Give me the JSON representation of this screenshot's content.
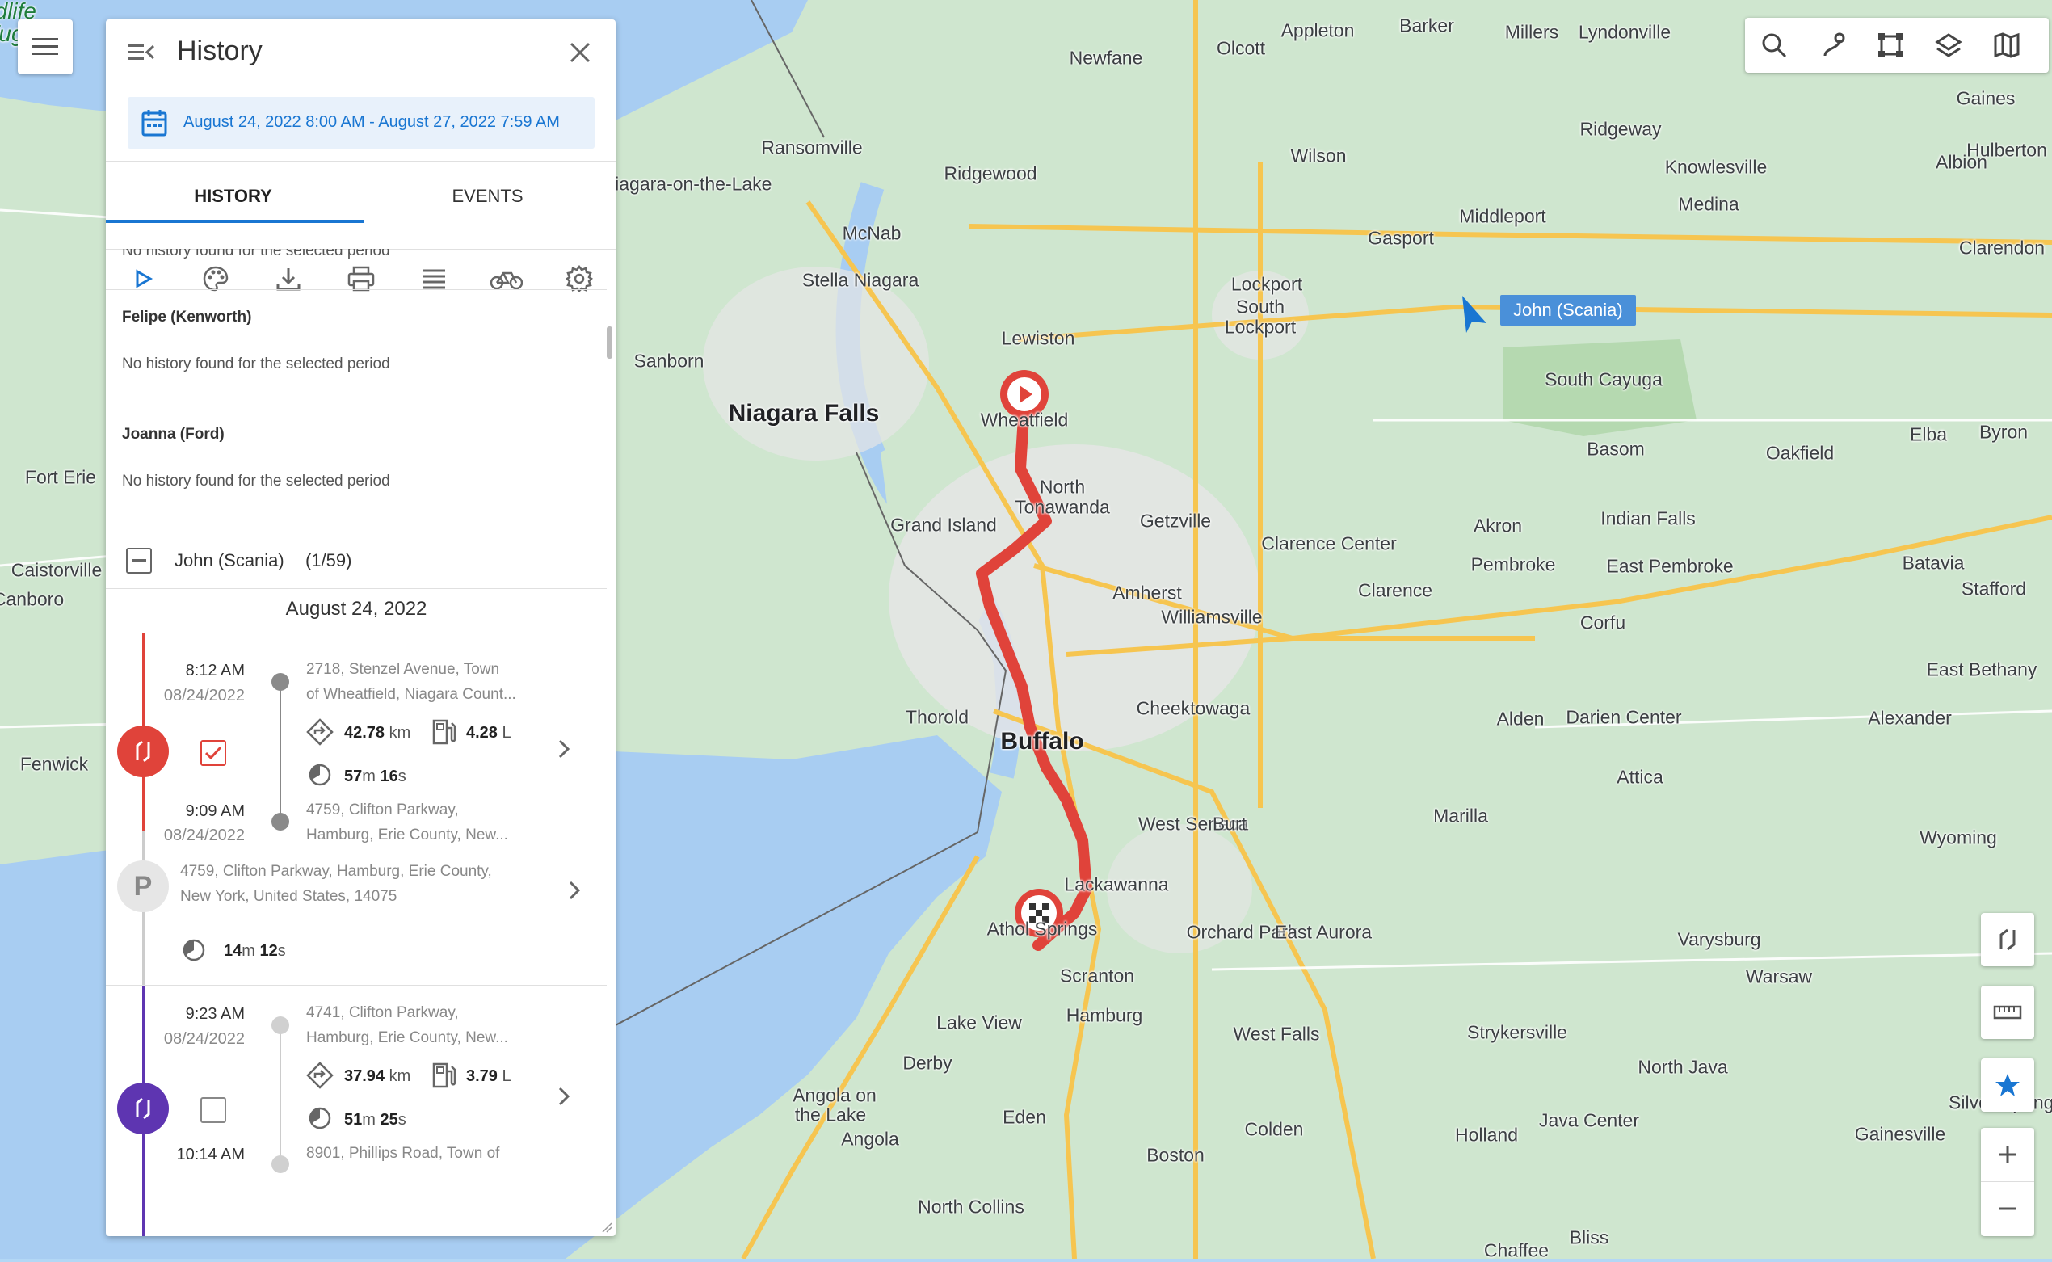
{
  "panel": {
    "title": "History",
    "date_range": "August 24, 2022 8:00 AM - August 27, 2022 7:59 AM",
    "tabs": [
      {
        "label": "HISTORY"
      },
      {
        "label": "EVENTS"
      }
    ],
    "active_tab": "HISTORY",
    "tools": [
      "play-icon",
      "palette-icon",
      "download-icon",
      "print-icon",
      "list-icon",
      "bike-icon",
      "gear-icon"
    ],
    "cut_text": "No history found for the selected period",
    "vehicles": [
      {
        "name": "Felipe (Kenworth)",
        "message": "No history found for the selected period"
      },
      {
        "name": "Joanna (Ford)",
        "message": "No history found for the selected period"
      }
    ],
    "group": {
      "name": "John (Scania)",
      "count": "(1/59)"
    },
    "day_header": "August 24, 2022",
    "trip1": {
      "start_time": "8:12 AM",
      "start_date": "08/24/2022",
      "start_addr1": "2718, Stenzel Avenue, Town",
      "start_addr2": "of Wheatfield, Niagara Count...",
      "distance": "42.78",
      "distance_unit": "km",
      "fuel": "4.28",
      "fuel_unit": "L",
      "dur_m": "57",
      "dur_m_unit": "m",
      "dur_s": "16",
      "dur_s_unit": "s",
      "end_time": "9:09 AM",
      "end_date": "08/24/2022",
      "end_addr1": "4759, Clifton Parkway,",
      "end_addr2": "Hamburg, Erie County, New..."
    },
    "stop": {
      "badge": "P",
      "addr1": "4759, Clifton Parkway, Hamburg, Erie County,",
      "addr2": "New York, United States, 14075",
      "dur_m": "14",
      "dur_m_unit": "m",
      "dur_s": "12",
      "dur_s_unit": "s"
    },
    "trip2": {
      "start_time": "9:23 AM",
      "start_date": "08/24/2022",
      "start_addr1": "4741, Clifton Parkway,",
      "start_addr2": "Hamburg, Erie County, New...",
      "distance": "37.94",
      "distance_unit": "km",
      "fuel": "3.79",
      "fuel_unit": "L",
      "dur_m": "51",
      "dur_m_unit": "m",
      "dur_s": "25",
      "dur_s_unit": "s",
      "end_time": "10:14 AM",
      "end_addr1": "8901, Phillips Road, Town of"
    }
  },
  "map": {
    "vehicle_label": "John (Scania)",
    "places": [
      {
        "name": "Niagara Falls",
        "size": "big"
      },
      {
        "name": "Buffalo",
        "size": "big"
      },
      {
        "name": "Lockport"
      },
      {
        "name": "South"
      },
      {
        "name": "Lockport"
      },
      {
        "name": "Wheatfield"
      },
      {
        "name": "North"
      },
      {
        "name": "Tonawanda"
      },
      {
        "name": "Grand Island"
      },
      {
        "name": "Getzville"
      },
      {
        "name": "Amherst"
      },
      {
        "name": "Williamsville"
      },
      {
        "name": "Cheektowaga"
      },
      {
        "name": "West Seneca"
      },
      {
        "name": "Lackawanna"
      },
      {
        "name": "Orchard Park"
      },
      {
        "name": "East Aurora"
      },
      {
        "name": "Hamburg"
      },
      {
        "name": "Scranton"
      },
      {
        "name": "Athol Springs"
      },
      {
        "name": "Lake View"
      },
      {
        "name": "Derby"
      },
      {
        "name": "Angola on"
      },
      {
        "name": "the Lake"
      },
      {
        "name": "Angola"
      },
      {
        "name": "Eden"
      },
      {
        "name": "Boston"
      },
      {
        "name": "Colden"
      },
      {
        "name": "North Collins"
      },
      {
        "name": "Chaffee"
      },
      {
        "name": "Bliss"
      },
      {
        "name": "Holland"
      },
      {
        "name": "West Falls"
      },
      {
        "name": "Marilla"
      },
      {
        "name": "Strykersville"
      },
      {
        "name": "Java Center"
      },
      {
        "name": "North Java"
      },
      {
        "name": "Varysburg"
      },
      {
        "name": "Warsaw"
      },
      {
        "name": "Gainesville"
      },
      {
        "name": "Silver Springs"
      },
      {
        "name": "Wyoming"
      },
      {
        "name": "Attica"
      },
      {
        "name": "Alexander"
      },
      {
        "name": "Darien Center"
      },
      {
        "name": "Alden"
      },
      {
        "name": "East Bethany"
      },
      {
        "name": "Batavia"
      },
      {
        "name": "Stafford"
      },
      {
        "name": "Byron"
      },
      {
        "name": "Elba"
      },
      {
        "name": "Oakfield"
      },
      {
        "name": "Basom"
      },
      {
        "name": "Indian Falls"
      },
      {
        "name": "Akron"
      },
      {
        "name": "Pembroke"
      },
      {
        "name": "East Pembroke"
      },
      {
        "name": "Corfu"
      },
      {
        "name": "Clarence"
      },
      {
        "name": "Clarence Center"
      },
      {
        "name": "Medina"
      },
      {
        "name": "Middleport"
      },
      {
        "name": "Gasport"
      },
      {
        "name": "Albion"
      },
      {
        "name": "Knowlesville"
      },
      {
        "name": "Ridgeway"
      },
      {
        "name": "Gaines"
      },
      {
        "name": "Hulberton"
      },
      {
        "name": "Clarendon"
      },
      {
        "name": "Lyndonville"
      },
      {
        "name": "Millers"
      },
      {
        "name": "Barker"
      },
      {
        "name": "Appleton"
      },
      {
        "name": "Olcott"
      },
      {
        "name": "Burt"
      },
      {
        "name": "Newfane"
      },
      {
        "name": "Wilson"
      },
      {
        "name": "Ridgewood"
      },
      {
        "name": "Ransomville"
      },
      {
        "name": "Niagara-on-the-Lake"
      },
      {
        "name": "McNab"
      },
      {
        "name": "Stella Niagara"
      },
      {
        "name": "Lewiston"
      },
      {
        "name": "Sanborn"
      },
      {
        "name": "Thorold"
      },
      {
        "name": "Fort Erie"
      },
      {
        "name": "Caistorville"
      },
      {
        "name": "Canboro"
      },
      {
        "name": "Fenwick"
      },
      {
        "name": "South Cayuga"
      },
      {
        "name": "Iroquois National Wildlife Refuge"
      }
    ],
    "right_controls": [
      "search-icon",
      "route-icon",
      "select-area-icon",
      "layers-icon",
      "map-icon"
    ],
    "side_controls": [
      "route-icon",
      "ruler-icon",
      "star-icon",
      "zoom-in-icon",
      "zoom-out-icon"
    ]
  }
}
